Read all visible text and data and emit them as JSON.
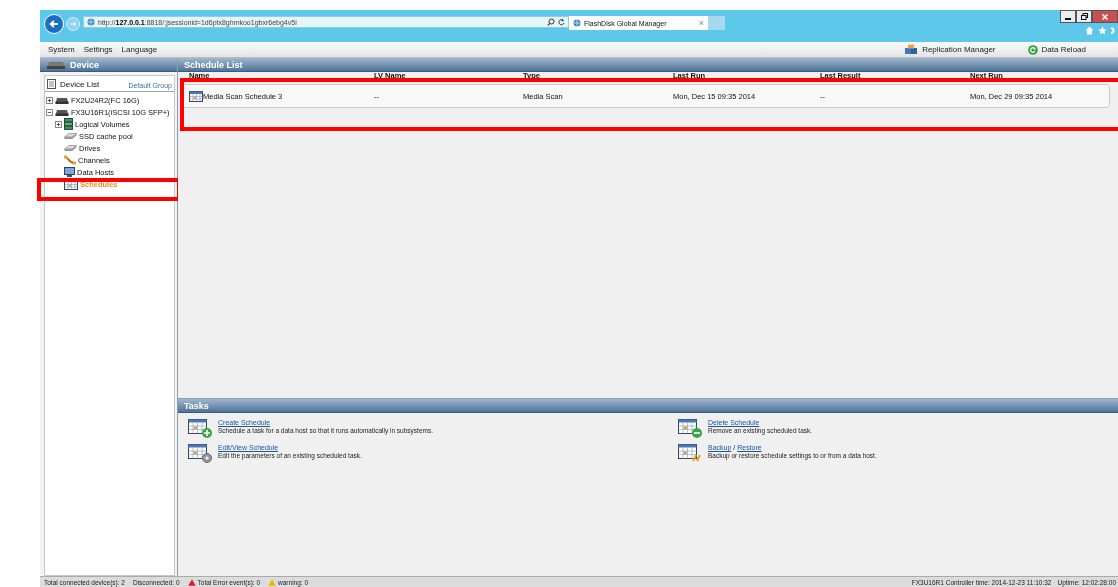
{
  "browser": {
    "address": "http://**127.0.0.1**:8818/;jsessionid=1d6ptx8ghmkoo1gbxr6ebg4v5i",
    "tab": {
      "title": "FlashDisk Global Manager",
      "close": "×"
    }
  },
  "menu": {
    "items": [
      "System",
      "Settings",
      "Language"
    ],
    "actions": [
      {
        "kind": "replication",
        "label": "Replication Manager"
      },
      {
        "kind": "reload",
        "label": "Data Reload"
      }
    ]
  },
  "sidebar": {
    "title": "Device",
    "list_label": "Device List",
    "group_link": "Default Group",
    "tree": [
      {
        "label": "FX2U24R2(FC 16G)",
        "kind": "device",
        "expanded": false,
        "selected": false,
        "highlighted": false
      },
      {
        "label": "FX3U16R1(iSCSI 10G SFP+)",
        "kind": "device",
        "expanded": true,
        "selected": false,
        "highlighted": false,
        "children": [
          {
            "label": "Logical Volumes",
            "kind": "volumes",
            "expanded": false,
            "selected": false,
            "highlighted": false
          },
          {
            "label": "SSD cache pool",
            "kind": "disk",
            "selected": false,
            "highlighted": false
          },
          {
            "label": "Drives",
            "kind": "disk",
            "selected": false,
            "highlighted": false
          },
          {
            "label": "Channels",
            "kind": "channel",
            "selected": false,
            "highlighted": false
          },
          {
            "label": "Data Hosts",
            "kind": "host",
            "selected": false,
            "highlighted": false
          },
          {
            "label": "Schedules",
            "kind": "schedule",
            "selected": true,
            "highlighted": true
          }
        ]
      }
    ]
  },
  "schedule_list": {
    "title": "Schedule List",
    "highlighted": true,
    "columns": [
      "Name",
      "LV Name",
      "Type",
      "Last Run",
      "Last Result",
      "Next Run"
    ],
    "rows": [
      {
        "cells": [
          "Media Scan Schedule 3",
          "--",
          "Media Scan",
          "Mon, Dec 15 09:35 2014",
          "--",
          "Mon, Dec 29 09:35 2014"
        ]
      }
    ]
  },
  "tasks": {
    "title": "Tasks",
    "items": [
      {
        "kind": "create",
        "links": [
          "Create Schedule"
        ],
        "description": "Schedule a task for a data host so that it runs automatically in subsystems."
      },
      {
        "kind": "delete",
        "links": [
          "Delete Schedule"
        ],
        "description": "Remove an existing scheduled task."
      },
      {
        "kind": "edit",
        "links": [
          "Edit/View Schedule"
        ],
        "description": "Edit the parameters of an existing scheduled task."
      },
      {
        "kind": "backup",
        "links": [
          "Backup",
          "Restore"
        ],
        "separator": "/",
        "description": "Backup or restore schedule settings to or from a data host."
      }
    ]
  },
  "status_bar": {
    "left": [
      {
        "kind": "plain",
        "text": "Total connected device(s): 2"
      },
      {
        "kind": "plain",
        "text": "Disconnected: 0"
      },
      {
        "kind": "error",
        "text": "Total Error event(s): 0"
      },
      {
        "kind": "warning",
        "text": "warning: 0"
      }
    ],
    "right": [
      "FX3U16R1  Controller time: 2014-12-23 11:10:32",
      "Uptime: 12:02:28:00"
    ]
  }
}
